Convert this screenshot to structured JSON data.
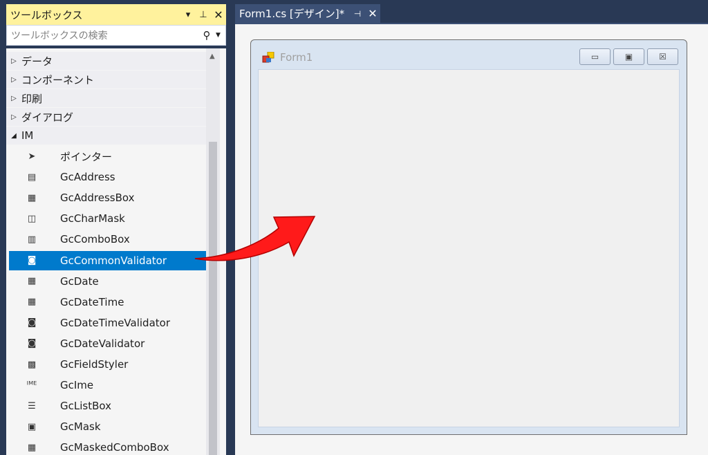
{
  "toolbox": {
    "title": "ツールボックス",
    "search_placeholder": "ツールボックスの検索",
    "categories": [
      {
        "label": "データ",
        "expanded": false
      },
      {
        "label": "コンポーネント",
        "expanded": false
      },
      {
        "label": "印刷",
        "expanded": false
      },
      {
        "label": "ダイアログ",
        "expanded": false
      },
      {
        "label": "IM",
        "expanded": true
      }
    ],
    "items": [
      {
        "label": "ポインター",
        "icon": "pointer-icon",
        "selected": false
      },
      {
        "label": "GcAddress",
        "icon": "gcaddress-icon",
        "selected": false
      },
      {
        "label": "GcAddressBox",
        "icon": "gcaddressbox-icon",
        "selected": false
      },
      {
        "label": "GcCharMask",
        "icon": "gccharmask-icon",
        "selected": false
      },
      {
        "label": "GcComboBox",
        "icon": "gccombobox-icon",
        "selected": false
      },
      {
        "label": "GcCommonValidator",
        "icon": "gccommonvalidator-icon",
        "selected": true
      },
      {
        "label": "GcDate",
        "icon": "gcdate-icon",
        "selected": false
      },
      {
        "label": "GcDateTime",
        "icon": "gcdatetime-icon",
        "selected": false
      },
      {
        "label": "GcDateTimeValidator",
        "icon": "gcdatetimevalidator-icon",
        "selected": false
      },
      {
        "label": "GcDateValidator",
        "icon": "gcdatevalidator-icon",
        "selected": false
      },
      {
        "label": "GcFieldStyler",
        "icon": "gcfieldstyler-icon",
        "selected": false
      },
      {
        "label": "GcIme",
        "icon": "gcime-icon",
        "selected": false
      },
      {
        "label": "GcListBox",
        "icon": "gclistbox-icon",
        "selected": false
      },
      {
        "label": "GcMask",
        "icon": "gcmask-icon",
        "selected": false
      },
      {
        "label": "GcMaskedComboBox",
        "icon": "gcmaskedcombobox-icon",
        "selected": false
      }
    ]
  },
  "designer": {
    "tab_label": "Form1.cs [デザイン]*",
    "form_title": "Form1"
  },
  "colors": {
    "selection": "#007acc",
    "header_active": "#fff29d",
    "ide_frame": "#293955",
    "arrow": "#ff0000"
  }
}
